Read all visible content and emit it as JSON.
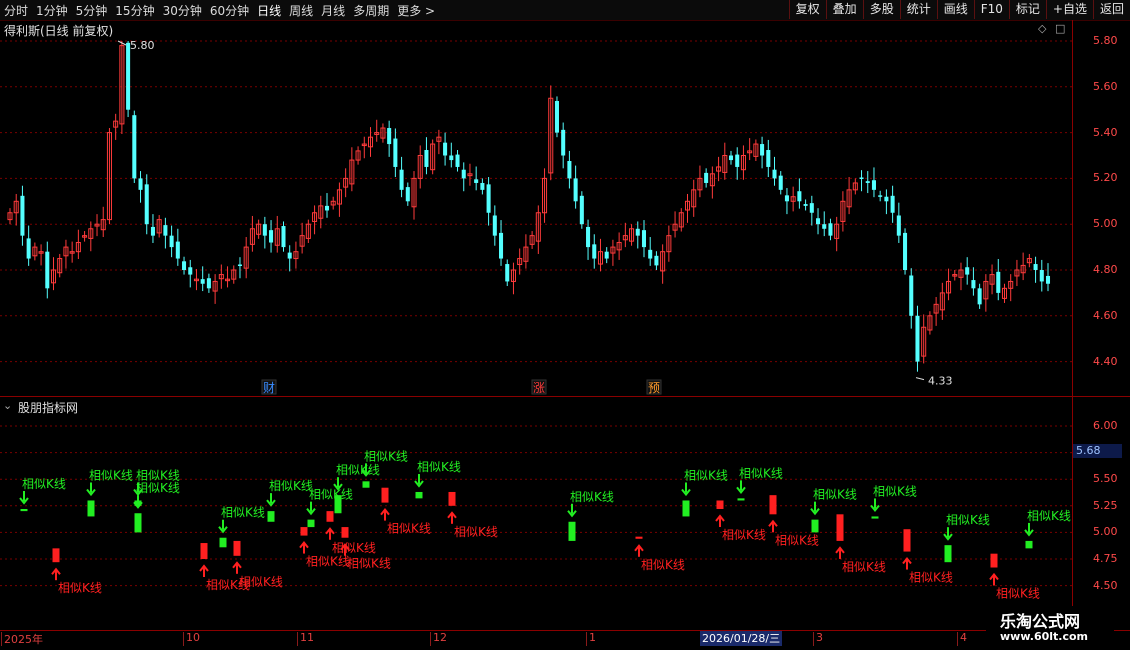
{
  "toolbar": {
    "left": [
      {
        "label": "分时",
        "active": false
      },
      {
        "label": "1分钟",
        "active": false
      },
      {
        "label": "5分钟",
        "active": false
      },
      {
        "label": "15分钟",
        "active": false
      },
      {
        "label": "30分钟",
        "active": false
      },
      {
        "label": "60分钟",
        "active": false
      },
      {
        "label": "日线",
        "active": true
      },
      {
        "label": "周线",
        "active": false
      },
      {
        "label": "月线",
        "active": false
      },
      {
        "label": "多周期",
        "active": false
      },
      {
        "label": "更多 >",
        "active": false
      }
    ],
    "right": [
      "复权",
      "叠加",
      "多股",
      "统计",
      "画线",
      "F10",
      "标记",
      "+自选",
      "返回"
    ]
  },
  "main_panel": {
    "title": "得利斯(日线 前复权)",
    "high_label": "5.80",
    "low_label": "4.33",
    "markers": [
      {
        "text": "财",
        "color": "#3a8cff"
      },
      {
        "text": "涨",
        "color": "#ff3b3b"
      },
      {
        "text": "预",
        "color": "#ff9a2a"
      }
    ],
    "y_ticks": [
      "5.80",
      "5.60",
      "5.40",
      "5.20",
      "5.00",
      "4.80",
      "4.60",
      "4.40"
    ]
  },
  "sub_panel": {
    "title": "股朋指标网",
    "y_ticks": [
      "6.00",
      "5.75",
      "5.50",
      "5.25",
      "5.00",
      "4.75",
      "4.50"
    ],
    "last_value": "5.68",
    "signal_label": "相似K线"
  },
  "time_axis": {
    "labels": [
      "2025年",
      "10",
      "11",
      "12",
      "1",
      "2026/01/28/三",
      "3",
      "4"
    ],
    "highlight": "2026/01/28/三"
  },
  "watermark": {
    "line1": "乐淘公式网",
    "line2": "www.60lt.com"
  },
  "colors": {
    "up": "#ff3b3b",
    "down": "#54ffff",
    "signal_up": "#ff2020",
    "signal_down": "#22ee22",
    "grid": "#7a0000"
  },
  "chart_data": {
    "type": "candlestick",
    "price_high": 5.8,
    "price_low": 4.33,
    "ylim": [
      4.3,
      5.85
    ]
  }
}
